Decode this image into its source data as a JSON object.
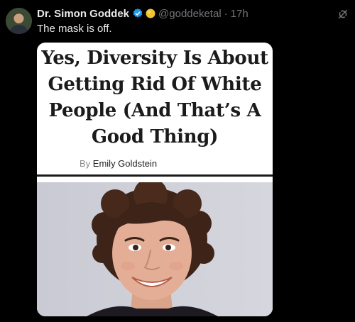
{
  "author": {
    "display_name": "Dr. Simon Goddek",
    "handle": "@goddeketal",
    "separator": "·",
    "timestamp": "17h",
    "verified_badge": "verified-badge-icon",
    "emoji": "yellow-circle-emoji"
  },
  "tweet": {
    "text": "The mask is off."
  },
  "article": {
    "headline": "Yes, Diversity Is About Getting Rid Of White People (And That’s A Good Thing)",
    "byline_prefix": "By",
    "author_name": "Emily Goldstein"
  },
  "colors": {
    "background": "#000000",
    "primary_text": "#e7e9ea",
    "secondary_text": "#71767b",
    "verified_blue": "#1d9bf0"
  }
}
